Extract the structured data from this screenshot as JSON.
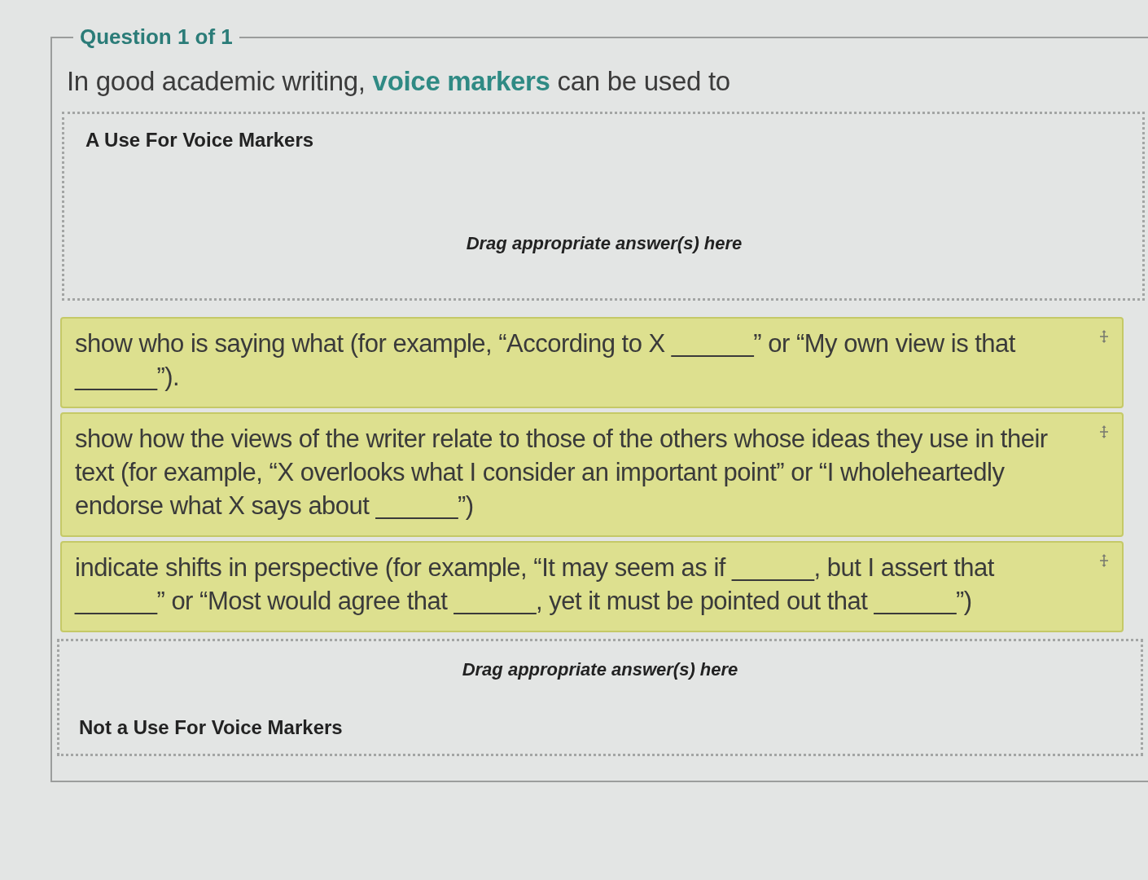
{
  "question": {
    "legend": "Question 1 of 1",
    "prompt": "In good academic writing, **voice markers** can be used to"
  },
  "items": [
    {
      "kind": "zone_label_top",
      "label": "A Use For Voice Markers",
      "placeholder": "Drag appropriate answer(s) here"
    },
    {
      "kind": "answer",
      "text": "show who is saying what (for example, “According to X ______” or “My own view is that ______”)."
    },
    {
      "kind": "answer",
      "text": "show how the views of the writer relate to those of the others whose ideas they use in their text (for example, “X overlooks what I consider an important point” or “I wholeheartedly endorse what X says about ______”)"
    },
    {
      "kind": "answer",
      "text": "indicate shifts in perspective (for example, “It may seem as if ______, but I assert that ______” or “Most would agree that ______, yet it must be pointed out that ______”)"
    },
    {
      "kind": "zone_label_bottom",
      "label": "Not a Use For Voice Markers",
      "placeholder": "Drag appropriate answer(s) here"
    }
  ]
}
